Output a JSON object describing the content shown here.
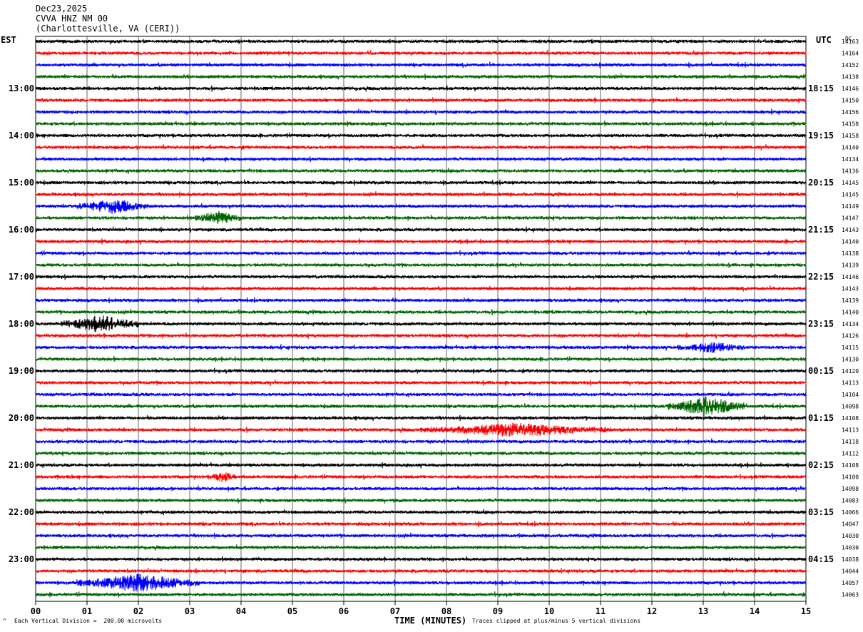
{
  "header": {
    "date": "Dec23,2025",
    "station": "CVVA HNZ NM 00",
    "location": "(Charlottesville, VA (CERI))"
  },
  "left_tz": "EST",
  "right_tz": "UTC",
  "dc_header": "DC",
  "footer": {
    "scale": "Each Vertical Division =  200.00 microvolts",
    "clip": "Traces clipped at plus/minus 5 vertical divisions",
    "mark": "^"
  },
  "chart_data": {
    "type": "line",
    "title": "CVVA HNZ NM 00",
    "xlabel": "TIME (MINUTES)",
    "x_ticks": [
      "00",
      "01",
      "02",
      "03",
      "04",
      "05",
      "06",
      "07",
      "08",
      "09",
      "10",
      "11",
      "12",
      "13",
      "14",
      "15"
    ],
    "xlim": [
      0,
      15
    ],
    "grid": true,
    "left_hour_labels": [
      "13:00",
      "14:00",
      "15:00",
      "16:00",
      "17:00",
      "18:00",
      "19:00",
      "20:00",
      "21:00",
      "22:00",
      "23:00"
    ],
    "right_hour_labels": [
      "18:15",
      "19:15",
      "20:15",
      "21:15",
      "22:15",
      "23:15",
      "00:15",
      "01:15",
      "02:15",
      "03:15",
      "04:15"
    ],
    "trace_colors": [
      "#000000",
      "#ff0000",
      "#0000ff",
      "#006400"
    ],
    "dc_offsets": [
      14163,
      14164,
      14152,
      14138,
      14146,
      14150,
      14156,
      14158,
      14158,
      14140,
      14134,
      14136,
      14145,
      14145,
      14149,
      14147,
      14143,
      14140,
      14138,
      14139,
      14146,
      14143,
      14139,
      14140,
      14134,
      14126,
      14115,
      14130,
      14120,
      14113,
      14104,
      14098,
      14108,
      14113,
      14118,
      14112,
      14108,
      14100,
      14098,
      14083,
      14066,
      14047,
      14030,
      14030,
      14038,
      14044,
      14057,
      14063
    ],
    "events": [
      {
        "trace": 14,
        "start_min": 0.8,
        "end_min": 2.2,
        "amp": 9
      },
      {
        "trace": 15,
        "start_min": 3.1,
        "end_min": 4.0,
        "amp": 8
      },
      {
        "trace": 24,
        "start_min": 0.5,
        "end_min": 2.0,
        "amp": 11
      },
      {
        "trace": 26,
        "start_min": 12.5,
        "end_min": 13.8,
        "amp": 6
      },
      {
        "trace": 31,
        "start_min": 12.3,
        "end_min": 13.8,
        "amp": 13
      },
      {
        "trace": 33,
        "start_min": 7.5,
        "end_min": 11.2,
        "amp": 8
      },
      {
        "trace": 37,
        "start_min": 3.4,
        "end_min": 3.9,
        "amp": 6
      },
      {
        "trace": 46,
        "start_min": 0.8,
        "end_min": 3.2,
        "amp": 11
      }
    ]
  }
}
